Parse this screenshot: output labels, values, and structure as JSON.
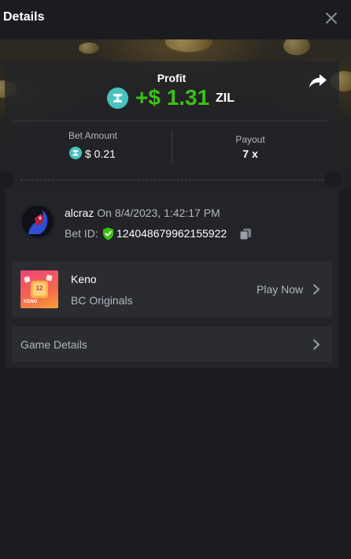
{
  "header": {
    "title": "Details"
  },
  "profit": {
    "label": "Profit",
    "amount": "+$ 1.31",
    "currency": "ZIL"
  },
  "bet": {
    "amount_label": "Bet Amount",
    "amount_value": "$ 0.21",
    "payout_label": "Payout",
    "payout_value": "7 x"
  },
  "user": {
    "name": "alcraz",
    "timestamp": "On 8/4/2023, 1:42:17 PM",
    "bet_id_label": "Bet ID:",
    "bet_id": "124048679962155922"
  },
  "game": {
    "name": "Keno",
    "provider": "BC Originals",
    "play_label": "Play Now",
    "thumb_text": "KENO",
    "thumb_number": "12"
  },
  "game_details": {
    "label": "Game Details"
  },
  "colors": {
    "background": "#1b1c1f",
    "profit_green": "#3bc117",
    "zil_teal": "#49c1bf",
    "muted_text": "#b3b6bd",
    "row_bg": "#2a2c31"
  },
  "icons": {
    "close": "close-icon",
    "share": "share-icon",
    "currency": "zilliqa-icon",
    "verified": "shield-check-icon",
    "copy": "copy-icon",
    "chevron": "chevron-right-icon"
  }
}
